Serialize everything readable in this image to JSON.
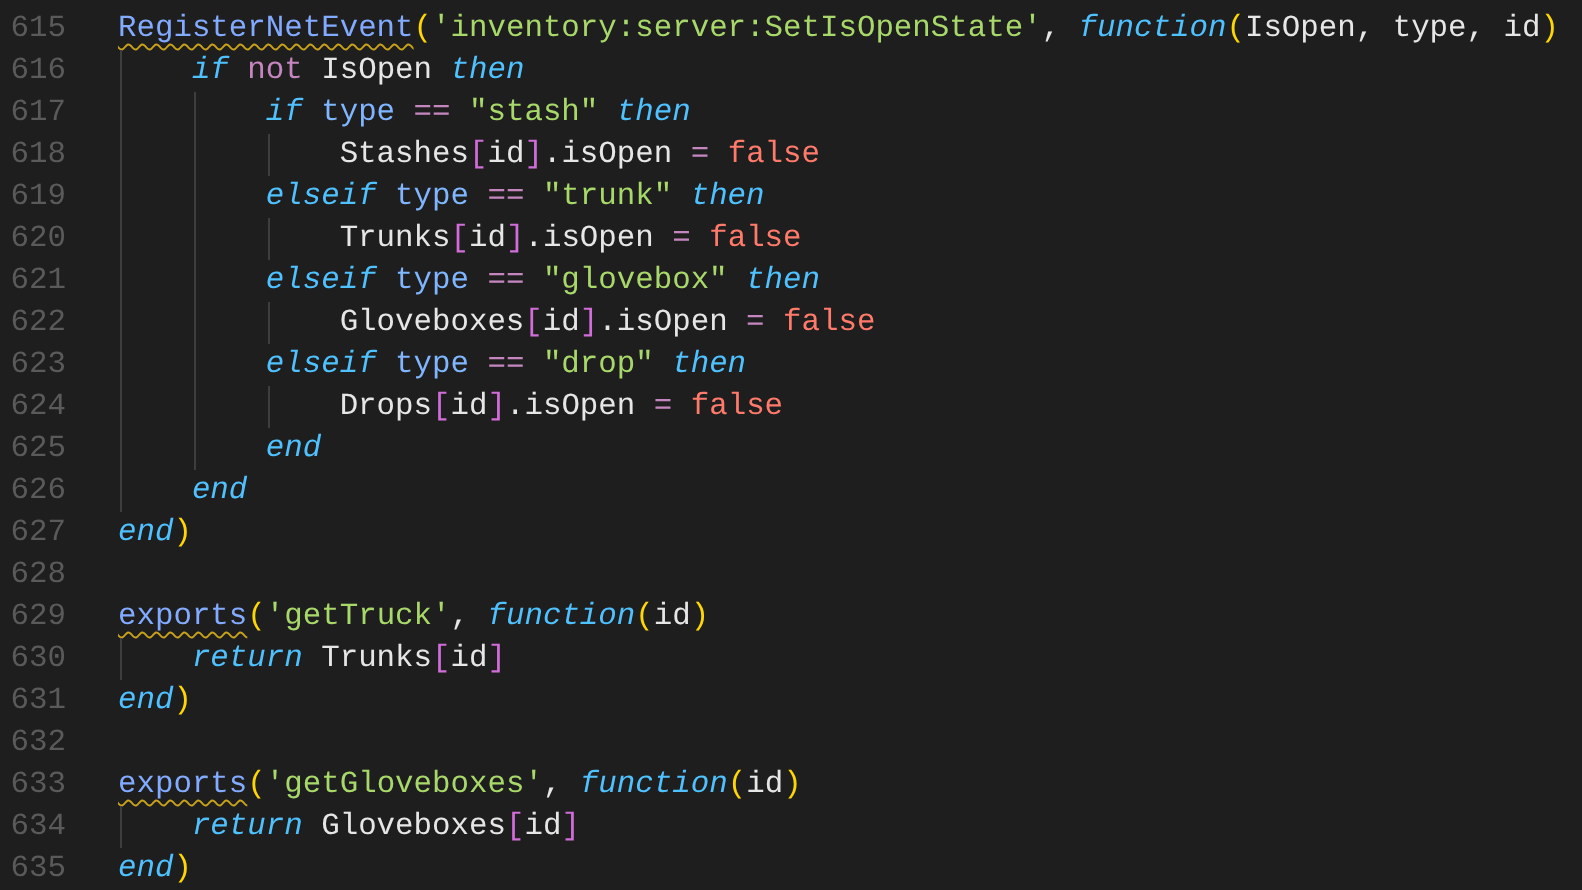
{
  "editor": {
    "lines": [
      {
        "number": "615",
        "tokens": [
          {
            "kind": "function",
            "text": "RegisterNetEvent",
            "warning": true
          },
          {
            "kind": "paren",
            "text": "("
          },
          {
            "kind": "string",
            "text": "'inventory:server:SetIsOpenState'"
          },
          {
            "kind": "plain",
            "text": ", "
          },
          {
            "kind": "keyword",
            "text": "function"
          },
          {
            "kind": "paren",
            "text": "("
          },
          {
            "kind": "plain",
            "text": "IsOpen, type, id"
          },
          {
            "kind": "paren",
            "text": ")"
          }
        ],
        "children": [
          {
            "number": "616",
            "tokens": [
              {
                "kind": "keyword",
                "text": "if "
              },
              {
                "kind": "operator",
                "text": "not "
              },
              {
                "kind": "plain",
                "text": "IsOpen "
              },
              {
                "kind": "keyword",
                "text": "then"
              }
            ],
            "children": [
              {
                "number": "617",
                "tokens": [
                  {
                    "kind": "keyword",
                    "text": "if "
                  },
                  {
                    "kind": "variable",
                    "text": "type "
                  },
                  {
                    "kind": "operator",
                    "text": "== "
                  },
                  {
                    "kind": "string",
                    "text": "\"stash\" "
                  },
                  {
                    "kind": "keyword",
                    "text": "then"
                  }
                ],
                "children": [
                  {
                    "number": "618",
                    "tokens": [
                      {
                        "kind": "plain",
                        "text": "Stashes"
                      },
                      {
                        "kind": "bracket",
                        "text": "["
                      },
                      {
                        "kind": "plain",
                        "text": "id"
                      },
                      {
                        "kind": "bracket",
                        "text": "]"
                      },
                      {
                        "kind": "plain",
                        "text": ".isOpen "
                      },
                      {
                        "kind": "operator",
                        "text": "= "
                      },
                      {
                        "kind": "boolean",
                        "text": "false"
                      }
                    ]
                  }
                ]
              },
              {
                "number": "619",
                "tokens": [
                  {
                    "kind": "keyword",
                    "text": "elseif "
                  },
                  {
                    "kind": "variable",
                    "text": "type "
                  },
                  {
                    "kind": "operator",
                    "text": "== "
                  },
                  {
                    "kind": "string",
                    "text": "\"trunk\" "
                  },
                  {
                    "kind": "keyword",
                    "text": "then"
                  }
                ],
                "children": [
                  {
                    "number": "620",
                    "tokens": [
                      {
                        "kind": "plain",
                        "text": "Trunks"
                      },
                      {
                        "kind": "bracket",
                        "text": "["
                      },
                      {
                        "kind": "plain",
                        "text": "id"
                      },
                      {
                        "kind": "bracket",
                        "text": "]"
                      },
                      {
                        "kind": "plain",
                        "text": ".isOpen "
                      },
                      {
                        "kind": "operator",
                        "text": "= "
                      },
                      {
                        "kind": "boolean",
                        "text": "false"
                      }
                    ]
                  }
                ]
              },
              {
                "number": "621",
                "tokens": [
                  {
                    "kind": "keyword",
                    "text": "elseif "
                  },
                  {
                    "kind": "variable",
                    "text": "type "
                  },
                  {
                    "kind": "operator",
                    "text": "== "
                  },
                  {
                    "kind": "string",
                    "text": "\"glovebox\" "
                  },
                  {
                    "kind": "keyword",
                    "text": "then"
                  }
                ],
                "children": [
                  {
                    "number": "622",
                    "tokens": [
                      {
                        "kind": "plain",
                        "text": "Gloveboxes"
                      },
                      {
                        "kind": "bracket",
                        "text": "["
                      },
                      {
                        "kind": "plain",
                        "text": "id"
                      },
                      {
                        "kind": "bracket",
                        "text": "]"
                      },
                      {
                        "kind": "plain",
                        "text": ".isOpen "
                      },
                      {
                        "kind": "operator",
                        "text": "= "
                      },
                      {
                        "kind": "boolean",
                        "text": "false"
                      }
                    ]
                  }
                ]
              },
              {
                "number": "623",
                "tokens": [
                  {
                    "kind": "keyword",
                    "text": "elseif "
                  },
                  {
                    "kind": "variable",
                    "text": "type "
                  },
                  {
                    "kind": "operator",
                    "text": "== "
                  },
                  {
                    "kind": "string",
                    "text": "\"drop\" "
                  },
                  {
                    "kind": "keyword",
                    "text": "then"
                  }
                ],
                "children": [
                  {
                    "number": "624",
                    "tokens": [
                      {
                        "kind": "plain",
                        "text": "Drops"
                      },
                      {
                        "kind": "bracket",
                        "text": "["
                      },
                      {
                        "kind": "plain",
                        "text": "id"
                      },
                      {
                        "kind": "bracket",
                        "text": "]"
                      },
                      {
                        "kind": "plain",
                        "text": ".isOpen "
                      },
                      {
                        "kind": "operator",
                        "text": "= "
                      },
                      {
                        "kind": "boolean",
                        "text": "false"
                      }
                    ]
                  }
                ]
              },
              {
                "number": "625",
                "tokens": [
                  {
                    "kind": "keyword",
                    "text": "end"
                  }
                ]
              }
            ]
          },
          {
            "number": "626",
            "tokens": [
              {
                "kind": "keyword",
                "text": "end"
              }
            ]
          }
        ]
      },
      {
        "number": "627",
        "tokens": [
          {
            "kind": "keyword",
            "text": "end"
          },
          {
            "kind": "paren",
            "text": ")"
          }
        ]
      },
      {
        "number": "628"
      },
      {
        "number": "629",
        "tokens": [
          {
            "kind": "function",
            "text": "exports",
            "warning": true
          },
          {
            "kind": "paren",
            "text": "("
          },
          {
            "kind": "string",
            "text": "'getTruck'"
          },
          {
            "kind": "plain",
            "text": ", "
          },
          {
            "kind": "keyword",
            "text": "function"
          },
          {
            "kind": "paren",
            "text": "("
          },
          {
            "kind": "plain",
            "text": "id"
          },
          {
            "kind": "paren",
            "text": ")"
          }
        ],
        "children": [
          {
            "number": "630",
            "tokens": [
              {
                "kind": "keyword",
                "text": "return "
              },
              {
                "kind": "plain",
                "text": "Trunks"
              },
              {
                "kind": "bracket",
                "text": "["
              },
              {
                "kind": "plain",
                "text": "id"
              },
              {
                "kind": "bracket",
                "text": "]"
              }
            ]
          }
        ]
      },
      {
        "number": "631",
        "tokens": [
          {
            "kind": "keyword",
            "text": "end"
          },
          {
            "kind": "paren",
            "text": ")"
          }
        ]
      },
      {
        "number": "632"
      },
      {
        "number": "633",
        "tokens": [
          {
            "kind": "function",
            "text": "exports",
            "warning": true
          },
          {
            "kind": "paren",
            "text": "("
          },
          {
            "kind": "string",
            "text": "'getGloveboxes'"
          },
          {
            "kind": "plain",
            "text": ", "
          },
          {
            "kind": "keyword",
            "text": "function"
          },
          {
            "kind": "paren",
            "text": "("
          },
          {
            "kind": "plain",
            "text": "id"
          },
          {
            "kind": "paren",
            "text": ")"
          }
        ],
        "children": [
          {
            "number": "634",
            "tokens": [
              {
                "kind": "keyword",
                "text": "return "
              },
              {
                "kind": "plain",
                "text": "Gloveboxes"
              },
              {
                "kind": "bracket",
                "text": "["
              },
              {
                "kind": "plain",
                "text": "id"
              },
              {
                "kind": "bracket",
                "text": "]"
              }
            ]
          }
        ]
      },
      {
        "number": "635",
        "tokens": [
          {
            "kind": "keyword",
            "text": "end"
          },
          {
            "kind": "paren",
            "text": ")"
          }
        ]
      }
    ]
  }
}
